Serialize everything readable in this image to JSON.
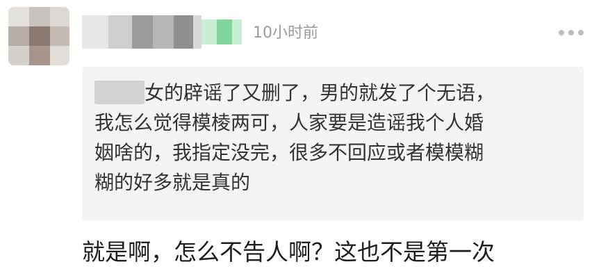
{
  "header": {
    "timestamp": "10小时前",
    "more_icon": "more-horizontal-icon"
  },
  "quote": {
    "text": "女的辟谣了又删了，男的就发了个无语，\n我怎么觉得模棱两可，人家要是造谣我个人婚\n姻啥的，我指定没完，很多不回应或者模模糊\n糊的好多就是真的"
  },
  "reply": {
    "text": "就是啊，怎么不告人啊？这也不是第一次"
  },
  "colors": {
    "quote_background": "#f4f4f4",
    "timestamp": "#9a9a9a",
    "badge_green": "#7fd59a"
  }
}
